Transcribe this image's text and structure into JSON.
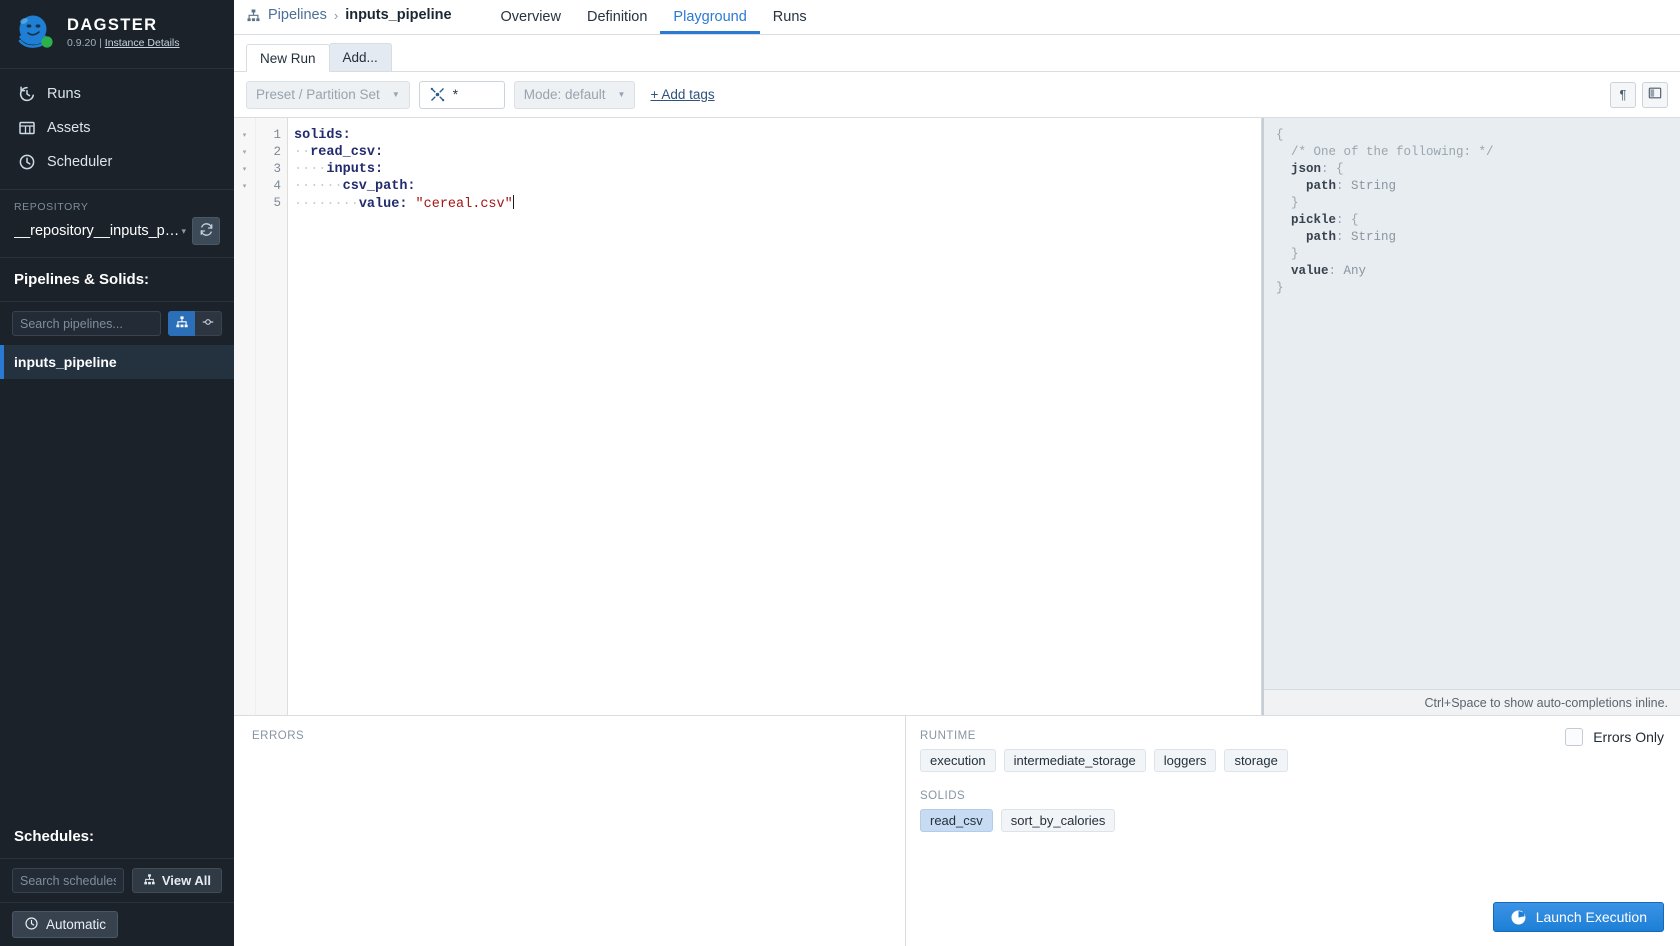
{
  "sidebar": {
    "brand": {
      "title": "DAGSTER",
      "version": "0.9.20",
      "separator": "|",
      "instance_link": "Instance Details"
    },
    "nav": [
      {
        "label": "Runs",
        "icon": "history-icon"
      },
      {
        "label": "Assets",
        "icon": "table-icon"
      },
      {
        "label": "Scheduler",
        "icon": "clock-icon"
      }
    ],
    "repository": {
      "label": "REPOSITORY",
      "name": "__repository__inputs_pipeline",
      "caret": "▾",
      "refresh_icon": "refresh-icon"
    },
    "pipelines_section": {
      "title": "Pipelines & Solids:",
      "search_placeholder": "Search pipelines...",
      "toggle_graph_icon": "hierarchy-icon",
      "toggle_solid_icon": "solid-icon"
    },
    "pipelines": [
      {
        "label": "inputs_pipeline"
      }
    ],
    "schedules_section": {
      "title": "Schedules:",
      "search_placeholder": "Search schedules...",
      "view_all": "View All",
      "view_all_icon": "hierarchy-icon"
    },
    "footer": {
      "automatic_label": "Automatic",
      "automatic_icon": "clock-icon"
    }
  },
  "topbar": {
    "breadcrumb_icon": "hierarchy-icon",
    "breadcrumb_root": "Pipelines",
    "breadcrumb_sep": "›",
    "breadcrumb_current": "inputs_pipeline",
    "tabs": [
      {
        "label": "Overview",
        "active": false
      },
      {
        "label": "Definition",
        "active": false
      },
      {
        "label": "Playground",
        "active": true
      },
      {
        "label": "Runs",
        "active": false
      }
    ]
  },
  "run_tabs": [
    {
      "label": "New Run",
      "active": true
    },
    {
      "label": "Add...",
      "active": false
    }
  ],
  "toolbar": {
    "preset_label": "Preset / Partition Set",
    "preset_caret": "▼",
    "solid_selection_icon": "solid-selection-icon",
    "solid_selection_value": "*",
    "mode_label": "Mode: default",
    "mode_caret": "▼",
    "add_tags": "+ Add tags",
    "whitespace_button_icon": "pilcrow-icon",
    "whitespace_button_label": "¶",
    "split_button_icon": "split-view-icon"
  },
  "editor": {
    "lines": [
      {
        "n": "1",
        "fold": true,
        "indent": 0,
        "key": "solids:",
        "value": ""
      },
      {
        "n": "2",
        "fold": true,
        "indent": 2,
        "key": "read_csv:",
        "value": ""
      },
      {
        "n": "3",
        "fold": true,
        "indent": 4,
        "key": "inputs:",
        "value": ""
      },
      {
        "n": "4",
        "fold": true,
        "indent": 6,
        "key": "csv_path:",
        "value": ""
      },
      {
        "n": "5",
        "fold": false,
        "indent": 8,
        "key": "value:",
        "value": " \"cereal.csv\""
      }
    ],
    "fold_glyph": "▾"
  },
  "schema": {
    "lines": [
      {
        "indent": 0,
        "parts": [
          {
            "t": "punc",
            "s": "{"
          }
        ]
      },
      {
        "indent": 1,
        "parts": [
          {
            "t": "com",
            "s": "/* One of the following: */"
          }
        ]
      },
      {
        "indent": 1,
        "parts": [
          {
            "t": "key",
            "s": "json"
          },
          {
            "t": "punc",
            "s": ": {"
          }
        ]
      },
      {
        "indent": 2,
        "parts": [
          {
            "t": "key",
            "s": "path"
          },
          {
            "t": "punc",
            "s": ": "
          },
          {
            "t": "type",
            "s": "String"
          }
        ]
      },
      {
        "indent": 1,
        "parts": [
          {
            "t": "punc",
            "s": "}"
          }
        ]
      },
      {
        "indent": 1,
        "parts": [
          {
            "t": "key",
            "s": "pickle"
          },
          {
            "t": "punc",
            "s": ": {"
          }
        ]
      },
      {
        "indent": 2,
        "parts": [
          {
            "t": "key",
            "s": "path"
          },
          {
            "t": "punc",
            "s": ": "
          },
          {
            "t": "type",
            "s": "String"
          }
        ]
      },
      {
        "indent": 1,
        "parts": [
          {
            "t": "punc",
            "s": "}"
          }
        ]
      },
      {
        "indent": 1,
        "parts": [
          {
            "t": "key",
            "s": "value"
          },
          {
            "t": "punc",
            "s": ": "
          },
          {
            "t": "type",
            "s": "Any"
          }
        ]
      },
      {
        "indent": 0,
        "parts": [
          {
            "t": "punc",
            "s": "}"
          }
        ]
      }
    ],
    "hint": "Ctrl+Space to show auto-completions inline."
  },
  "bottom": {
    "errors_label": "ERRORS",
    "runtime_label": "RUNTIME",
    "runtime_chips": [
      {
        "label": "execution",
        "selected": false
      },
      {
        "label": "intermediate_storage",
        "selected": false
      },
      {
        "label": "loggers",
        "selected": false
      },
      {
        "label": "storage",
        "selected": false
      }
    ],
    "solids_label": "SOLIDS",
    "solid_chips": [
      {
        "label": "read_csv",
        "selected": true
      },
      {
        "label": "sort_by_calories",
        "selected": false
      }
    ],
    "errors_only_label": "Errors Only",
    "errors_only_checked": false,
    "launch_label": "Launch Execution",
    "launch_icon": "launch-icon"
  },
  "colors": {
    "accent": "#2a7ad4",
    "sidebar_bg": "#1b222a",
    "chip_selected": "#c7dcf2",
    "launch_button": "#1c7fd6"
  }
}
